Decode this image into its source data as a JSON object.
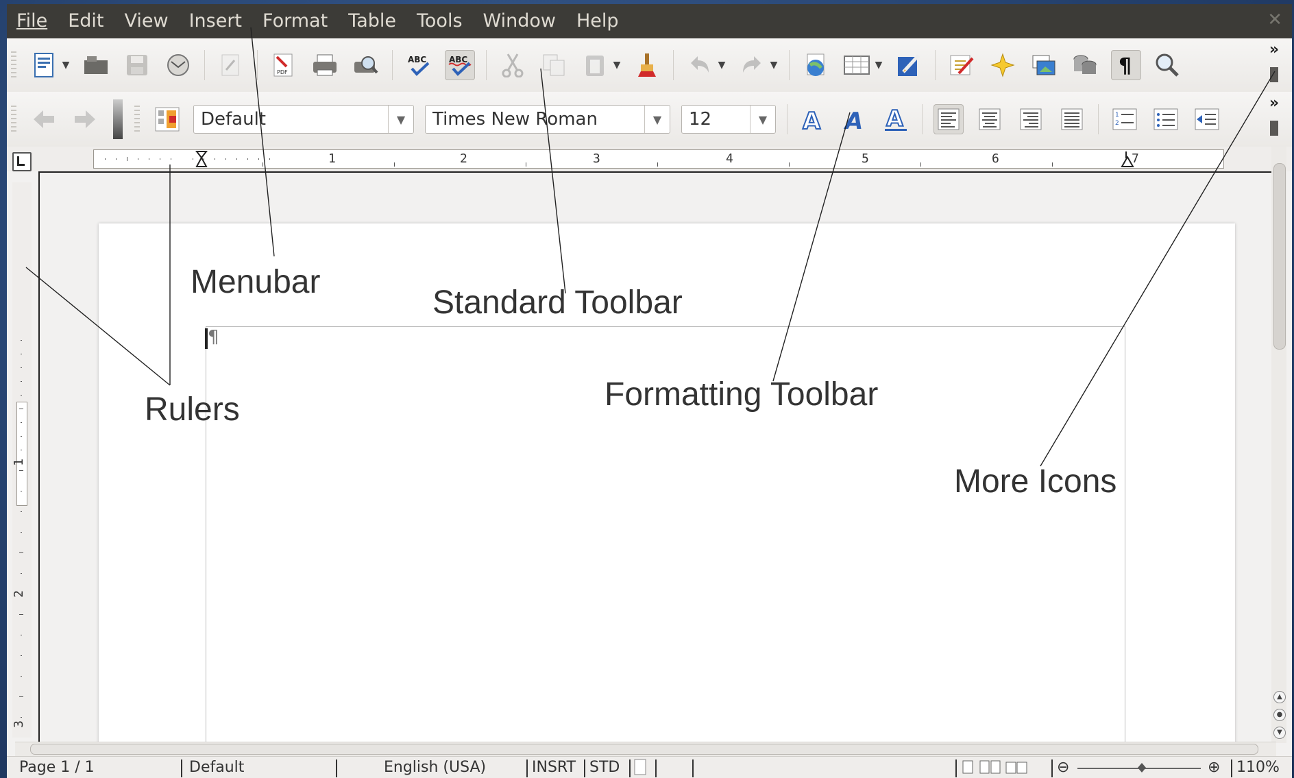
{
  "menubar": {
    "items": [
      "File",
      "Edit",
      "View",
      "Insert",
      "Format",
      "Table",
      "Tools",
      "Window",
      "Help"
    ],
    "close_glyph": "✕"
  },
  "standard_toolbar": {
    "icons": [
      "new-document-icon",
      "open-icon",
      "save-icon",
      "email-icon",
      "edit-file-icon",
      "export-pdf-icon",
      "print-icon",
      "print-preview-icon",
      "spellcheck-icon",
      "autospellcheck-icon",
      "cut-icon",
      "copy-icon",
      "paste-icon",
      "clone-formatting-icon",
      "undo-icon",
      "redo-icon",
      "navigator-icon",
      "table-icon",
      "draw-functions-icon",
      "gallery-icon",
      "data-sources-icon",
      "formatting-marks-icon",
      "zoom-icon"
    ],
    "more_glyph": "»"
  },
  "formatting_toolbar": {
    "paragraph_style": "Default",
    "font_name": "Times New Roman",
    "font_size": "12",
    "more_glyph": "»"
  },
  "ruler": {
    "numbers": [
      "1",
      "2",
      "3",
      "4",
      "5",
      "6",
      "7"
    ],
    "vertical_numbers": [
      "1",
      "2",
      "3"
    ]
  },
  "document": {
    "pilcrow": "¶"
  },
  "statusbar": {
    "page": "Page 1 / 1",
    "style": "Default",
    "language": "English (USA)",
    "insert_mode": "INSRT",
    "selection_mode": "STD",
    "zoom": "110%",
    "zoom_out": "⊖",
    "zoom_in": "⊕"
  },
  "annotations": {
    "menubar": "Menubar",
    "standard_toolbar": "Standard Toolbar",
    "formatting_toolbar": "Formatting Toolbar",
    "rulers": "Rulers",
    "more_icons": "More Icons"
  },
  "colors": {
    "menubar_bg": "#3c3b37",
    "desktop_bg": "#2a4a7a",
    "accent_red": "#d12b2b",
    "accent_blue": "#2e62b8"
  }
}
